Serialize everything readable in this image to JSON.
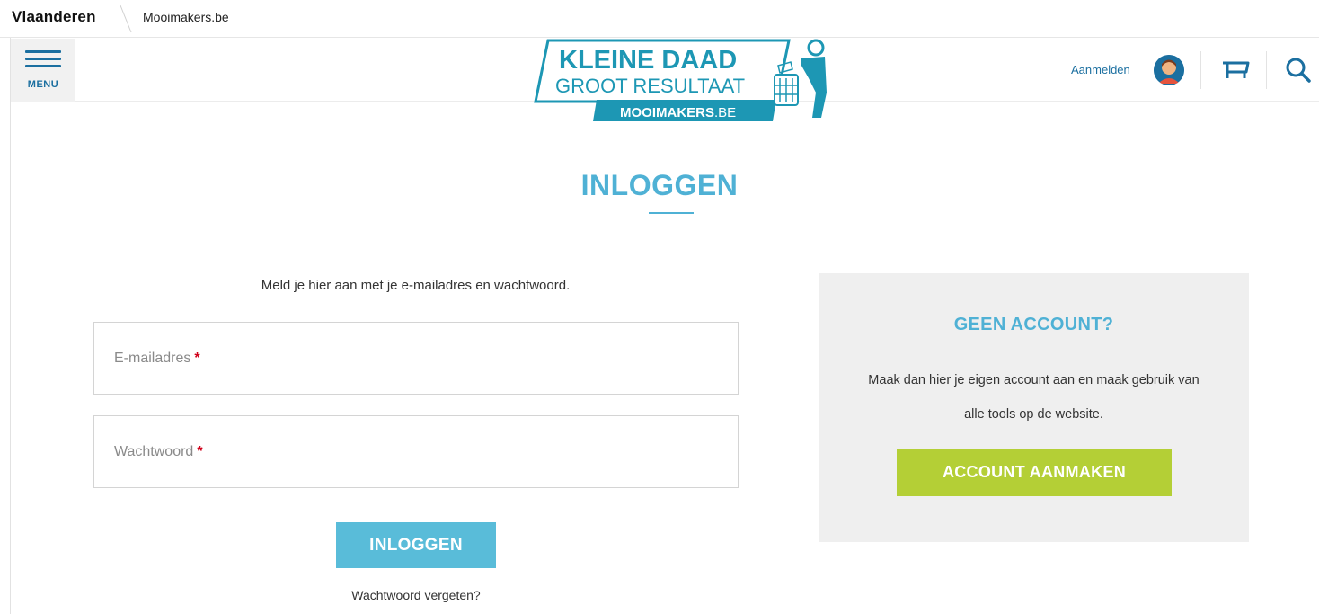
{
  "topbar": {
    "brand": "Vlaanderen",
    "site": "Mooimakers.be"
  },
  "header": {
    "menu_label": "MENU",
    "logo": {
      "line1": "KLEINE DAAD",
      "line2": "GROOT RESULTAAT",
      "line3_bold": "MOOIMAKERS",
      "line3_light": ".BE"
    },
    "login_link": "Aanmelden",
    "icons": [
      "user-avatar",
      "cart-icon",
      "search-icon"
    ]
  },
  "page": {
    "title": "INLOGGEN"
  },
  "login_form": {
    "intro": "Meld je hier aan met je e-mailadres en wachtwoord.",
    "email_placeholder": "E-mailadres",
    "password_placeholder": "Wachtwoord",
    "required_mark": "*",
    "submit_label": "INLOGGEN",
    "forgot_label": "Wachtwoord vergeten?"
  },
  "signup_panel": {
    "heading": "GEEN ACCOUNT?",
    "text": "Maak dan hier je eigen account aan en maak gebruik van alle tools op de website.",
    "button_label": "ACCOUNT AANMAKEN"
  },
  "colors": {
    "accent": "#4fb1d5",
    "button_blue": "#59bcd9",
    "button_green": "#b4cf36",
    "nav_blue": "#1b6fa0",
    "panel_bg": "#efefef"
  }
}
